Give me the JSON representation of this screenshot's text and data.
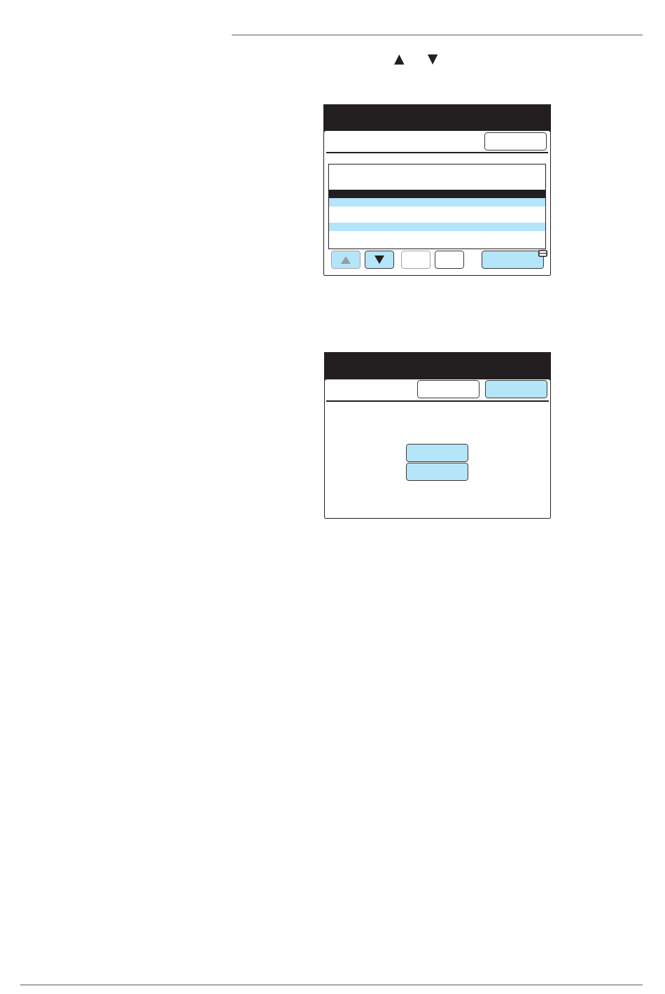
{
  "instruction": {
    "symbols": [
      "▲",
      "▼"
    ]
  },
  "screens": [
    {
      "kind": "list",
      "header_buttons": [
        {
          "highlighted": false,
          "disabled": false
        }
      ],
      "list_rows": [
        {
          "selected": true,
          "shaded": false
        },
        {
          "selected": false,
          "shaded": true
        },
        {
          "selected": false,
          "shaded": true
        }
      ],
      "footer_buttons": [
        {
          "kind": "arrow_up",
          "highlighted": true,
          "disabled": true
        },
        {
          "kind": "arrow_down",
          "highlighted": true,
          "disabled": false
        },
        {
          "kind": "blank",
          "highlighted": false,
          "disabled": true
        },
        {
          "kind": "blank",
          "highlighted": false,
          "disabled": false
        },
        {
          "kind": "tabbed",
          "highlighted": true,
          "disabled": false
        }
      ]
    },
    {
      "kind": "options",
      "header_buttons": [
        {
          "highlighted": false,
          "disabled": false
        },
        {
          "highlighted": true,
          "disabled": false
        }
      ],
      "option_buttons": [
        {
          "highlighted": true,
          "disabled": false
        },
        {
          "highlighted": true,
          "disabled": false
        }
      ]
    }
  ]
}
